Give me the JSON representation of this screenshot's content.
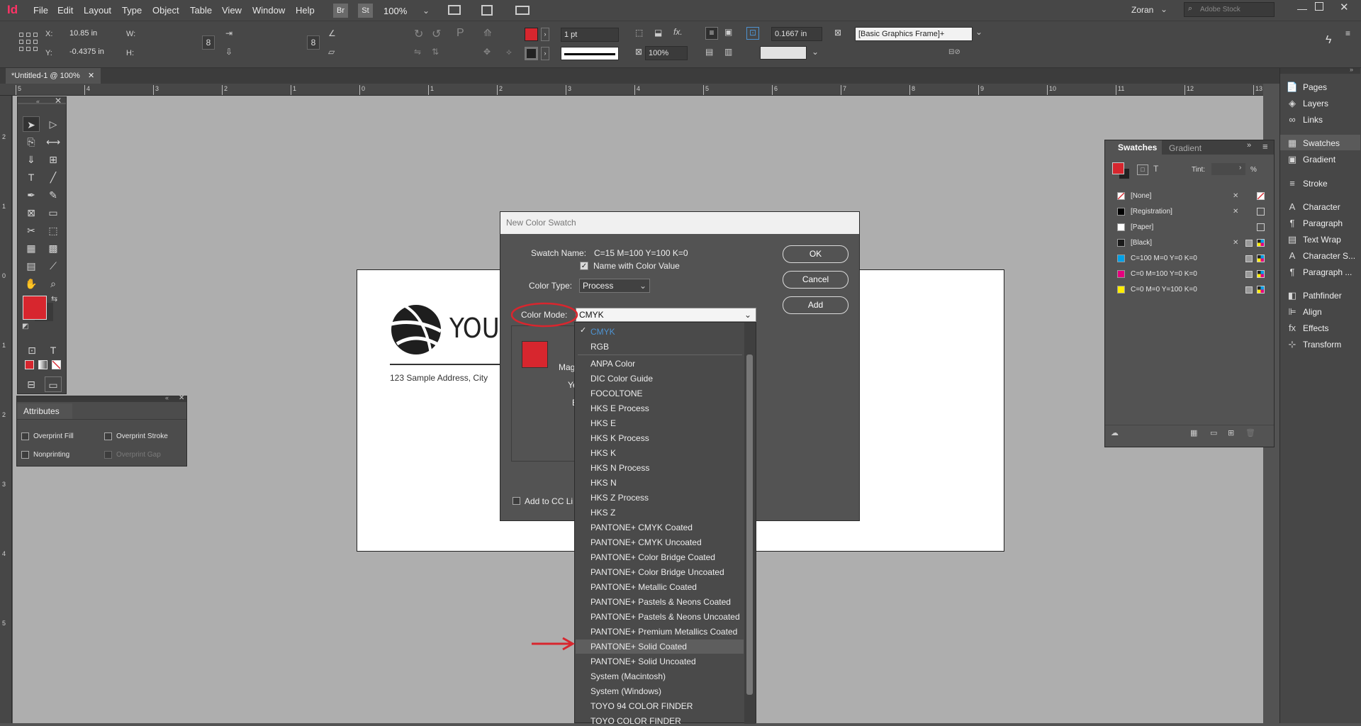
{
  "app": {
    "logo": "Id",
    "user": "Zoran",
    "stock_placeholder": "Adobe Stock",
    "zoom": "100%",
    "br": "Br",
    "st": "St"
  },
  "menus": [
    "File",
    "Edit",
    "Layout",
    "Type",
    "Object",
    "Table",
    "View",
    "Window",
    "Help"
  ],
  "control": {
    "x_label": "X:",
    "y_label": "Y:",
    "w_label": "W:",
    "h_label": "H:",
    "x": "10.85 in",
    "y": "-0.4375 in",
    "stroke_weight": "1 pt",
    "scale": "100%",
    "offset": "0.1667 in",
    "style": "[Basic Graphics Frame]+"
  },
  "document": {
    "tab": "*Untitled-1 @ 100%",
    "address": "123 Sample Address, City",
    "brand_text": "YOUR"
  },
  "ruler": [
    "5",
    "4",
    "3",
    "2",
    "1",
    "0",
    "1",
    "2",
    "3",
    "4",
    "5",
    "6",
    "7",
    "8",
    "9",
    "10",
    "11",
    "12",
    "13"
  ],
  "vruler": [
    "2",
    "1",
    "0",
    "1",
    "2",
    "3",
    "4",
    "5"
  ],
  "attributes": {
    "title": "Attributes",
    "overprint_fill": "Overprint Fill",
    "overprint_stroke": "Overprint Stroke",
    "nonprinting": "Nonprinting",
    "overprint_gap": "Overprint Gap"
  },
  "dialog": {
    "title": "New Color Swatch",
    "swatch_name_label": "Swatch Name:",
    "swatch_name": "C=15 M=100 Y=100 K=0",
    "name_with_value": "Name with Color Value",
    "color_type_label": "Color Type:",
    "color_type": "Process",
    "color_mode_label": "Color Mode:",
    "color_mode": "CMYK",
    "partial_labels": [
      "Mag",
      "Ye",
      "E"
    ],
    "ok": "OK",
    "cancel": "Cancel",
    "add": "Add",
    "add_cc": "Add to CC Li",
    "preview_color": "#d7262e"
  },
  "dropdown": {
    "top": [
      "CMYK",
      "RGB"
    ],
    "items": [
      "ANPA Color",
      "DIC Color Guide",
      "FOCOLTONE",
      "HKS E Process",
      "HKS E",
      "HKS K Process",
      "HKS K",
      "HKS N Process",
      "HKS N",
      "HKS Z Process",
      "HKS Z",
      "PANTONE+ CMYK Coated",
      "PANTONE+ CMYK Uncoated",
      "PANTONE+ Color Bridge Coated",
      "PANTONE+ Color Bridge Uncoated",
      "PANTONE+ Metallic Coated",
      "PANTONE+ Pastels & Neons Coated",
      "PANTONE+ Pastels & Neons Uncoated",
      "PANTONE+ Premium Metallics Coated",
      "PANTONE+ Solid Coated",
      "PANTONE+ Solid Uncoated",
      "System (Macintosh)",
      "System (Windows)",
      "TOYO 94 COLOR FINDER",
      "TOYO COLOR FINDER"
    ],
    "selected": "CMYK",
    "highlighted": "PANTONE+ Solid Coated"
  },
  "swatches": {
    "tabs": [
      "Swatches",
      "Gradient"
    ],
    "tint_label": "Tint:",
    "percent": "%",
    "rows": [
      {
        "name": "[None]",
        "color": "#ffffff"
      },
      {
        "name": "[Registration]",
        "color": "#000000"
      },
      {
        "name": "[Paper]",
        "color": "#ffffff"
      },
      {
        "name": "[Black]",
        "color": "#1a1a1a"
      },
      {
        "name": "C=100 M=0 Y=0 K=0",
        "color": "#00a0e6"
      },
      {
        "name": "C=0 M=100 Y=0 K=0",
        "color": "#e6007e"
      },
      {
        "name": "C=0 M=0 Y=100 K=0",
        "color": "#ffed00"
      }
    ]
  },
  "dock": [
    "Pages",
    "Layers",
    "Links",
    "Swatches",
    "Gradient",
    "Stroke",
    "Character",
    "Paragraph",
    "Text Wrap",
    "Character S...",
    "Paragraph ...",
    "Pathfinder",
    "Align",
    "Effects",
    "Transform"
  ],
  "colors": {
    "accent": "#d7262e",
    "annotation": "#d8262e",
    "highlight": "#4e93d1"
  }
}
